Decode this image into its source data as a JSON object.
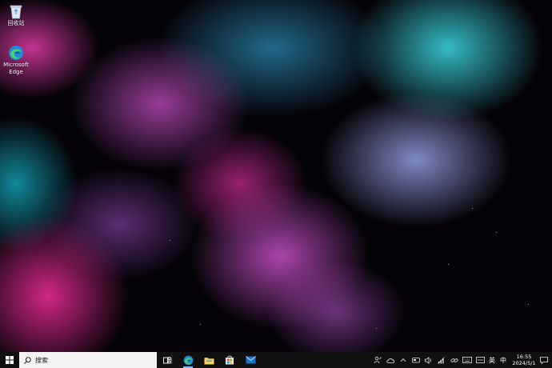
{
  "desktop": {
    "icons": [
      {
        "label": "回收站",
        "icon": "recycle-bin-icon"
      },
      {
        "label": "Microsoft Edge",
        "icon": "edge-icon"
      }
    ]
  },
  "taskbar": {
    "start_icon": "windows-start-icon",
    "search_placeholder": "搜索",
    "pinned": [
      {
        "icon": "task-view-icon"
      },
      {
        "icon": "edge-icon",
        "active": true
      },
      {
        "icon": "file-explorer-icon"
      },
      {
        "icon": "microsoft-store-icon"
      },
      {
        "icon": "mail-icon"
      }
    ],
    "tray": {
      "input_language": "英",
      "ime_mode": "中",
      "time": "16:55",
      "date": "2024/5/1"
    }
  },
  "colors": {
    "taskbar_bg": "#101010",
    "search_bg": "#f3f3f3",
    "accent": "#0078d4"
  }
}
